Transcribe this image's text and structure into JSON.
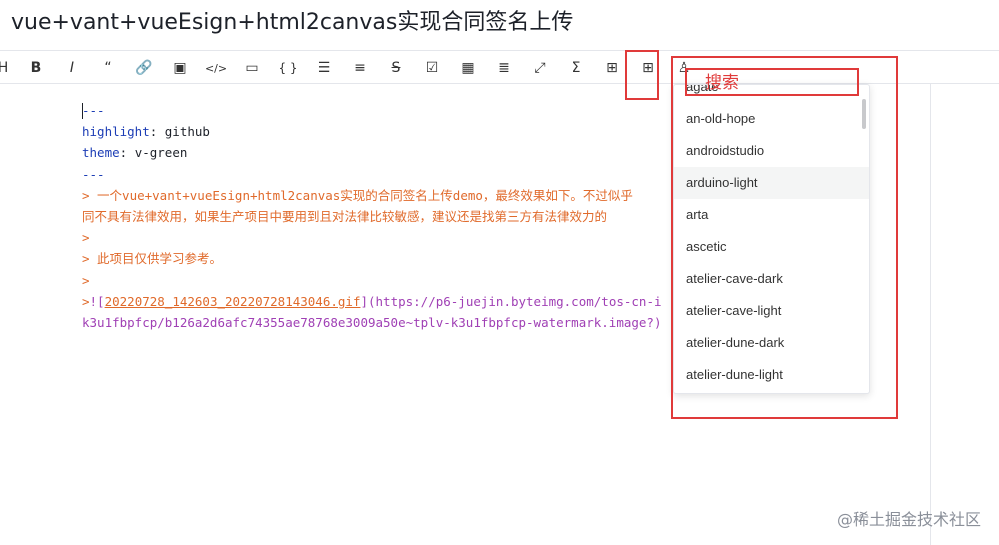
{
  "title": "vue+vant+vueEsign+html2canvas实现合同签名上传",
  "toolbar": {
    "items": [
      {
        "name": "heading-icon",
        "glyph": "H"
      },
      {
        "name": "bold-icon",
        "glyph": "B"
      },
      {
        "name": "italic-icon",
        "glyph": "I"
      },
      {
        "name": "quote-icon",
        "glyph": "“"
      },
      {
        "name": "link-icon",
        "glyph": "🔗"
      },
      {
        "name": "image-icon",
        "glyph": "▣"
      },
      {
        "name": "code-icon",
        "glyph": "</>"
      },
      {
        "name": "code-block-icon",
        "glyph": "▭"
      },
      {
        "name": "braces-icon",
        "glyph": "{ }"
      },
      {
        "name": "unordered-list-icon",
        "glyph": "☰"
      },
      {
        "name": "ordered-list-icon",
        "glyph": "≡"
      },
      {
        "name": "strikethrough-icon",
        "glyph": "S"
      },
      {
        "name": "checkbox-icon",
        "glyph": "☑"
      },
      {
        "name": "table-icon",
        "glyph": "▦"
      },
      {
        "name": "align-icon",
        "glyph": "≣"
      },
      {
        "name": "fullscreen-icon",
        "glyph": "⤢"
      },
      {
        "name": "formula-icon",
        "glyph": "Σ"
      },
      {
        "name": "diagram-icon",
        "glyph": "⊞"
      },
      {
        "name": "theme-grid-icon",
        "glyph": "⊞"
      },
      {
        "name": "highlight-theme-icon",
        "glyph": "♙"
      }
    ]
  },
  "editor": {
    "lines": [
      {
        "parts": [
          {
            "c": "blue",
            "t": "---"
          }
        ]
      },
      {
        "parts": [
          {
            "c": "blue",
            "t": "highlight"
          },
          {
            "c": "",
            "t": ": github"
          }
        ]
      },
      {
        "parts": [
          {
            "c": "blue",
            "t": "theme"
          },
          {
            "c": "",
            "t": ": v-green"
          }
        ]
      },
      {
        "parts": [
          {
            "c": "blue",
            "t": "---"
          }
        ]
      },
      {
        "parts": [
          {
            "c": "orange",
            "t": "> 一个vue+vant+vueEsign+html2canvas实现的合同签名上传demo，最终效果如下。不过似乎"
          }
        ]
      },
      {
        "parts": [
          {
            "c": "orange",
            "t": "同不具有法律效用，如果生产项目中要用到且对法律比较敏感，建议还是找第三方有法律效力的"
          }
        ]
      },
      {
        "parts": [
          {
            "c": "orange",
            "t": ">"
          }
        ]
      },
      {
        "parts": [
          {
            "c": "orange",
            "t": "> 此项目仅供学习参考。"
          }
        ]
      },
      {
        "parts": [
          {
            "c": "orange",
            "t": ">"
          }
        ]
      },
      {
        "parts": [
          {
            "c": "orange",
            "t": ">"
          },
          {
            "c": "purple",
            "t": "!["
          },
          {
            "c": "link",
            "t": "20220728_142603_20220728143046.gif"
          },
          {
            "c": "purple",
            "t": "](https://p6-juejin.byteimg.com/tos-cn-i"
          }
        ]
      },
      {
        "parts": [
          {
            "c": "purple",
            "t": "k3u1fbpfcp/b126a2d6afc74355ae78768e3009a50e~tplv-k3u1fbpfcp-watermark.image?)"
          }
        ]
      }
    ]
  },
  "dropdown": {
    "items": [
      "agate",
      "an-old-hope",
      "androidstudio",
      "arduino-light",
      "arta",
      "ascetic",
      "atelier-cave-dark",
      "atelier-cave-light",
      "atelier-dune-dark",
      "atelier-dune-light"
    ],
    "active_index": 3
  },
  "annotation": {
    "label": "搜索",
    "color": "#e03a3a"
  },
  "watermark": "@稀土掘金技术社区"
}
